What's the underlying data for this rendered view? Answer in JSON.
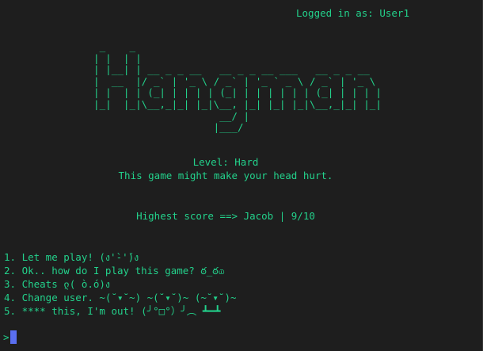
{
  "header": {
    "login_text": "Logged in as: User1"
  },
  "banner": {
    "ascii_art": " _    _\n| |  | |\n| |__| | __ _ _ __   __ _ _ __ ___   __ _ _ __\n|  __  |/ _` | '_ \\ / _` | '_ ` _ \\ / _` | '_ \\\n| |  | | (_| | | | | (_| | | | | | | (_| | | | |\n|_|  |_|\\__,_|_| |_|\\__, |_| |_| |_|\\__,_|_| |_|\n                     __/ |\n                    |___/"
  },
  "info": {
    "level": "Level: Hard",
    "tagline": "This game might make your head hurt.",
    "highscore": "Highest score ==> Jacob | 9/10"
  },
  "menu": {
    "items": [
      {
        "label": "1. Let me play! (ง'̀-'́)ง"
      },
      {
        "label": "2. Ok.. how do I play this game? ఠ_ఠ௰"
      },
      {
        "label": "3. Cheats ლ( ò.ó)ง"
      },
      {
        "label": "4. Change user. ~(˘▾˘~) ~(˘▾˘)~ (~˘▾˘)~"
      },
      {
        "label": "5. **** this, I'm out! (╯°□°）╯︵ ┻━┻"
      }
    ]
  },
  "prompt": {
    "symbol": ">"
  },
  "colors": {
    "background": "#1e1e1e",
    "text": "#23d18b",
    "cursor": "#5a6ff0"
  }
}
